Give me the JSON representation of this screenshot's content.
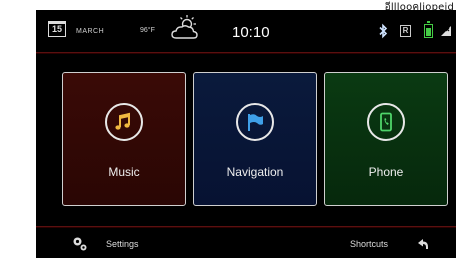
{
  "corner_label": "อีlllooคliopeid",
  "status": {
    "calendar_day": "15",
    "month": "MARCH",
    "temperature": "96°F",
    "weather_icon": "partly-cloudy-icon",
    "time": "10:10",
    "bluetooth_icon": "bluetooth-icon",
    "r_badge": "R",
    "battery_color": "#44cc44",
    "signal_icon": "signal-icon"
  },
  "tiles": [
    {
      "label": "Music",
      "icon": "music-note-icon",
      "color": "#3a0a06"
    },
    {
      "label": "Navigation",
      "icon": "flag-icon",
      "color": "#0a1a3c"
    },
    {
      "label": "Phone",
      "icon": "phone-icon",
      "color": "#0a3a12"
    }
  ],
  "bottom": {
    "settings_label": "Settings",
    "shortcuts_label": "Shortcuts"
  }
}
